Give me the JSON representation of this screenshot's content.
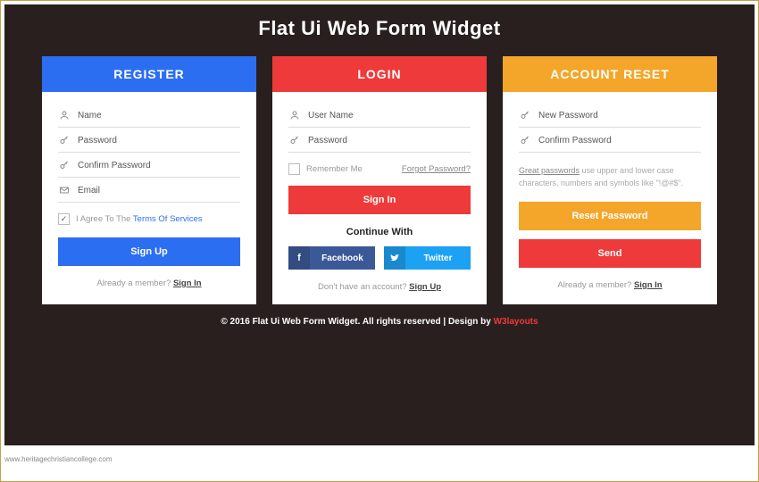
{
  "page": {
    "title": "Flat Ui Web Form Widget",
    "footer_prefix": "© 2016 Flat Ui Web Form Widget. All rights reserved | Design by ",
    "footer_brand": "W3layouts",
    "watermark": "www.heritagechristiancollege.com"
  },
  "register": {
    "header": "REGISTER",
    "name_ph": "Name",
    "password_ph": "Password",
    "confirm_ph": "Confirm Password",
    "email_ph": "Email",
    "agree_prefix": "I Agree To The ",
    "agree_link": "Terms Of Services",
    "submit": "Sign Up",
    "footer_q": "Already a member? ",
    "footer_link": "Sign In"
  },
  "login": {
    "header": "LOGIN",
    "user_ph": "User Name",
    "password_ph": "Password",
    "remember": "Remember Me",
    "forgot": "Forgot Password?",
    "submit": "Sign In",
    "continue": "Continue With",
    "fb": "Facebook",
    "tw": "Twitter",
    "footer_q": "Don't have an account? ",
    "footer_link": "Sign Up"
  },
  "reset": {
    "header": "ACCOUNT RESET",
    "new_ph": "New Password",
    "confirm_ph": "Confirm Password",
    "hint_lead": "Great passwords",
    "hint_rest": " use upper and lower case characters, numbers and symbols like \"!@#$\".",
    "reset_btn": "Reset Password",
    "send_btn": "Send",
    "footer_q": "Already a member? ",
    "footer_link": "Sign In"
  }
}
